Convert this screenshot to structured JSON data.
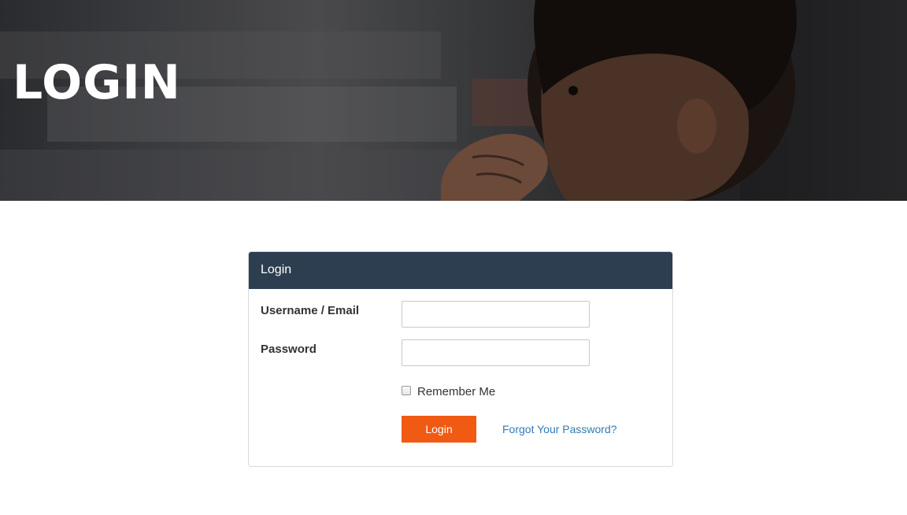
{
  "hero": {
    "title": "LOGIN"
  },
  "login_panel": {
    "heading": "Login",
    "username_label": "Username / Email",
    "username_value": "",
    "password_label": "Password",
    "password_value": "",
    "remember_label": "Remember Me",
    "remember_checked": false,
    "submit_label": "Login",
    "forgot_link": "Forgot Your Password?"
  },
  "colors": {
    "panel_heading_bg": "#2c3e50",
    "button_bg": "#f05a12",
    "link": "#337ab7"
  }
}
